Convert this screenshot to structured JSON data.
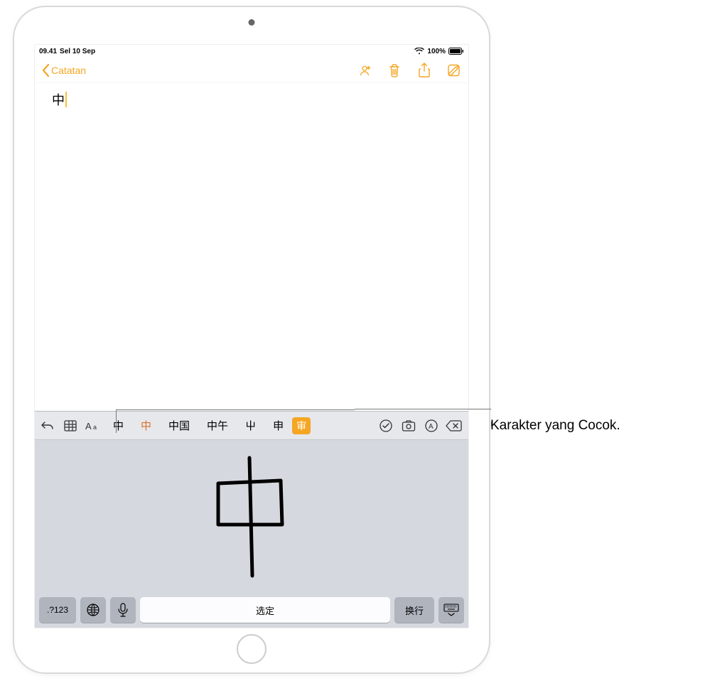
{
  "status": {
    "time": "09.41",
    "date": "Sel 10 Sep",
    "battery_pct": "100%"
  },
  "nav": {
    "back_label": "Catatan"
  },
  "note": {
    "content": "中"
  },
  "candidate_bar": {
    "items": [
      {
        "text": "中",
        "style": "plain"
      },
      {
        "text": "中",
        "style": "em"
      },
      {
        "text": "中国",
        "style": "plain"
      },
      {
        "text": "中午",
        "style": "plain"
      },
      {
        "text": "屮",
        "style": "plain"
      },
      {
        "text": "申",
        "style": "plain"
      },
      {
        "text": "审",
        "style": "highlighted"
      }
    ]
  },
  "keyboard": {
    "num_label": ".?123",
    "space_label": "选定",
    "return_label": "换行"
  },
  "callout": {
    "text": "Karakter yang Cocok."
  }
}
